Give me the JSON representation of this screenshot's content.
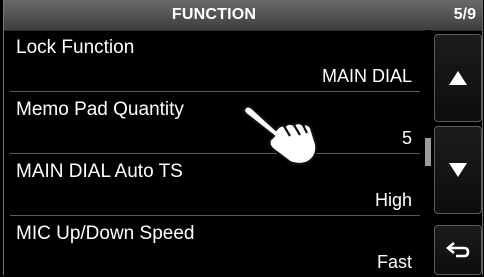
{
  "header": {
    "title": "FUNCTION",
    "page_indicator": "5/9"
  },
  "items": [
    {
      "label": "Lock Function",
      "value": "MAIN DIAL"
    },
    {
      "label": "Memo Pad Quantity",
      "value": "5"
    },
    {
      "label": "MAIN DIAL Auto TS",
      "value": "High"
    },
    {
      "label": "MIC Up/Down Speed",
      "value": "Fast"
    }
  ],
  "controls": {
    "up_icon": "triangle-up-icon",
    "down_icon": "triangle-down-icon",
    "back_icon": "return-arrow-icon"
  },
  "overlay": {
    "icon": "pointing-hand-icon"
  },
  "colors": {
    "background": "#000000",
    "text": "#ffffff",
    "titlebar": "#5a5a5a",
    "divider": "#5a5a5a"
  }
}
